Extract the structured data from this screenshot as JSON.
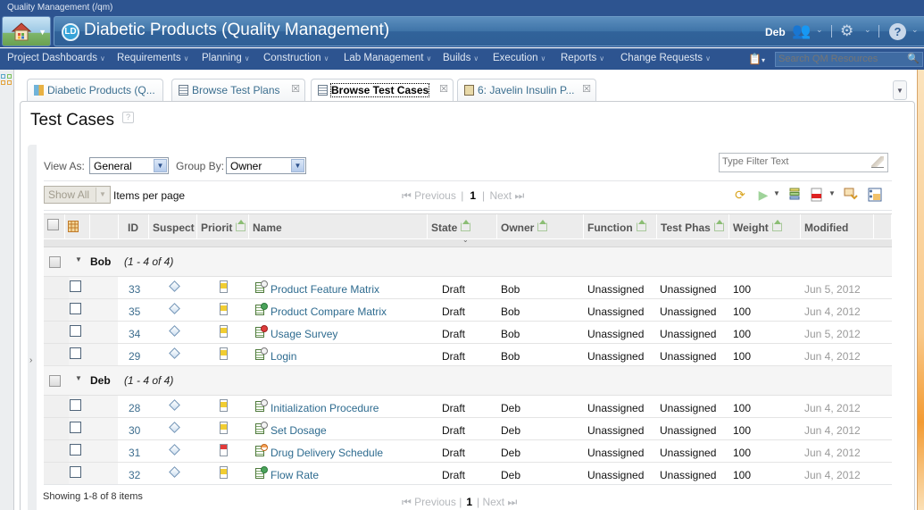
{
  "app": {
    "title": "Quality Management (/qm)",
    "project_title": "Diabetic Products (Quality Management)",
    "project_logo": "LD",
    "user": "Deb"
  },
  "header_icons": {
    "users": "users-icon",
    "settings": "gear-icon",
    "help": "?"
  },
  "menu": [
    {
      "label": "Project Dashboards"
    },
    {
      "label": "Requirements"
    },
    {
      "label": "Planning"
    },
    {
      "label": "Construction"
    },
    {
      "label": "Lab Management"
    },
    {
      "label": "Builds"
    },
    {
      "label": "Execution"
    },
    {
      "label": "Reports"
    },
    {
      "label": "Change Requests"
    }
  ],
  "search": {
    "placeholder": "Search QM Resources"
  },
  "tabs": [
    {
      "label": "Diabetic Products (Q...",
      "closable": false,
      "active": false
    },
    {
      "label": "Browse Test Plans",
      "closable": true,
      "active": false
    },
    {
      "label": "Browse Test Cases",
      "closable": true,
      "active": true
    },
    {
      "label": "6: Javelin Insulin P...",
      "closable": true,
      "active": false
    }
  ],
  "page": {
    "title": "Test Cases",
    "help": "?",
    "view_as_label": "View As:",
    "view_as_value": "General",
    "group_by_label": "Group By:",
    "group_by_value": "Owner",
    "filter_placeholder": "Type Filter Text",
    "page_size_value": "Show All",
    "items_per_page_label": "Items per page",
    "pager": {
      "previous": "Previous",
      "current": "1",
      "next": "Next"
    },
    "footer_status": "Showing 1-8 of 8 items"
  },
  "columns": {
    "id": "ID",
    "suspect": "Suspect",
    "priority": "Priorit",
    "name": "Name",
    "state": "State",
    "owner": "Owner",
    "function": "Function",
    "test_phase": "Test Phas",
    "weight": "Weight",
    "modified": "Modified"
  },
  "groups": [
    {
      "name": "Bob",
      "count": "(1 - 4 of 4)",
      "rows": [
        {
          "id": "33",
          "priority": "medium",
          "status": "draft",
          "name": "Product Feature Matrix",
          "state": "Draft",
          "owner": "Bob",
          "function": "Unassigned",
          "test_phase": "Unassigned",
          "weight": "100",
          "modified": "Jun 5, 2012"
        },
        {
          "id": "35",
          "priority": "medium",
          "status": "approved",
          "name": "Product Compare Matrix",
          "state": "Draft",
          "owner": "Bob",
          "function": "Unassigned",
          "test_phase": "Unassigned",
          "weight": "100",
          "modified": "Jun 4, 2012"
        },
        {
          "id": "34",
          "priority": "medium",
          "status": "rejected",
          "name": "Usage Survey",
          "state": "Draft",
          "owner": "Bob",
          "function": "Unassigned",
          "test_phase": "Unassigned",
          "weight": "100",
          "modified": "Jun 5, 2012"
        },
        {
          "id": "29",
          "priority": "medium",
          "status": "draft",
          "name": "Login",
          "state": "Draft",
          "owner": "Bob",
          "function": "Unassigned",
          "test_phase": "Unassigned",
          "weight": "100",
          "modified": "Jun 4, 2012"
        }
      ]
    },
    {
      "name": "Deb",
      "count": "(1 - 4 of 4)",
      "rows": [
        {
          "id": "28",
          "priority": "medium",
          "status": "draft",
          "name": "Initialization Procedure",
          "state": "Draft",
          "owner": "Deb",
          "function": "Unassigned",
          "test_phase": "Unassigned",
          "weight": "100",
          "modified": "Jun 4, 2012"
        },
        {
          "id": "30",
          "priority": "medium",
          "status": "draft",
          "name": "Set Dosage",
          "state": "Draft",
          "owner": "Deb",
          "function": "Unassigned",
          "test_phase": "Unassigned",
          "weight": "100",
          "modified": "Jun 4, 2012"
        },
        {
          "id": "31",
          "priority": "high",
          "status": "review",
          "name": "Drug Delivery Schedule",
          "state": "Draft",
          "owner": "Deb",
          "function": "Unassigned",
          "test_phase": "Unassigned",
          "weight": "100",
          "modified": "Jun 4, 2012"
        },
        {
          "id": "32",
          "priority": "medium",
          "status": "approved",
          "name": "Flow Rate",
          "state": "Draft",
          "owner": "Deb",
          "function": "Unassigned",
          "test_phase": "Unassigned",
          "weight": "100",
          "modified": "Jun 4, 2012"
        }
      ]
    }
  ],
  "colors": {
    "banner": "#2d5490",
    "link": "#2e6b8f",
    "priority_medium": "#f1cd32",
    "priority_high": "#e23a3a",
    "accent_orange": "#f39b33"
  }
}
